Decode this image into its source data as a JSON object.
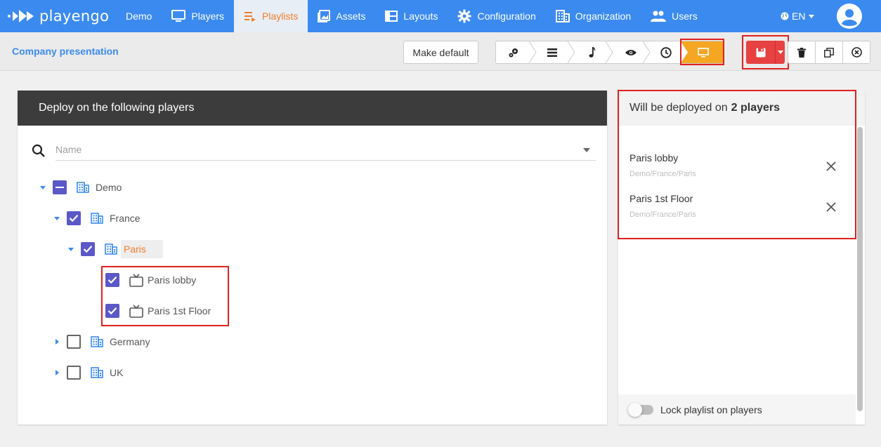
{
  "app": {
    "logo_text": "playengo"
  },
  "nav": {
    "items": [
      {
        "label": "Demo",
        "icon": "none"
      },
      {
        "label": "Players",
        "icon": "monitor-icon"
      },
      {
        "label": "Playlists",
        "icon": "playlist-icon",
        "active": true
      },
      {
        "label": "Assets",
        "icon": "image-icon"
      },
      {
        "label": "Layouts",
        "icon": "layout-icon"
      },
      {
        "label": "Configuration",
        "icon": "gear-icon"
      },
      {
        "label": "Organization",
        "icon": "building-icon"
      },
      {
        "label": "Users",
        "icon": "users-icon"
      }
    ],
    "language": "EN"
  },
  "toolbar": {
    "title": "Company presentation",
    "make_default_label": "Make default",
    "steps": [
      "settings-icon",
      "list-icon",
      "music-note-icon",
      "eye-icon",
      "clock-icon",
      "monitor-icon"
    ],
    "active_step": 5
  },
  "deploy": {
    "header": "Deploy on the following players",
    "search_placeholder": "Name",
    "tree": {
      "demo": "Demo",
      "france": "France",
      "paris": "Paris",
      "paris_lobby": "Paris lobby",
      "paris_1st": "Paris 1st Floor",
      "germany": "Germany",
      "uk": "UK"
    }
  },
  "summary": {
    "header_prefix": "Will be deployed on",
    "header_count": "2 players",
    "items": [
      {
        "name": "Paris lobby",
        "path": "Demo/France/Paris"
      },
      {
        "name": "Paris 1st Floor",
        "path": "Demo/France/Paris"
      }
    ],
    "lock_label": "Lock playlist on players"
  },
  "colors": {
    "brand": "#3b8af0",
    "active_nav_text": "#f07d2b",
    "checkbox": "#5b58c8",
    "save": "#e84141",
    "active_step": "#f5a623",
    "highlight": "#e01f1f"
  }
}
